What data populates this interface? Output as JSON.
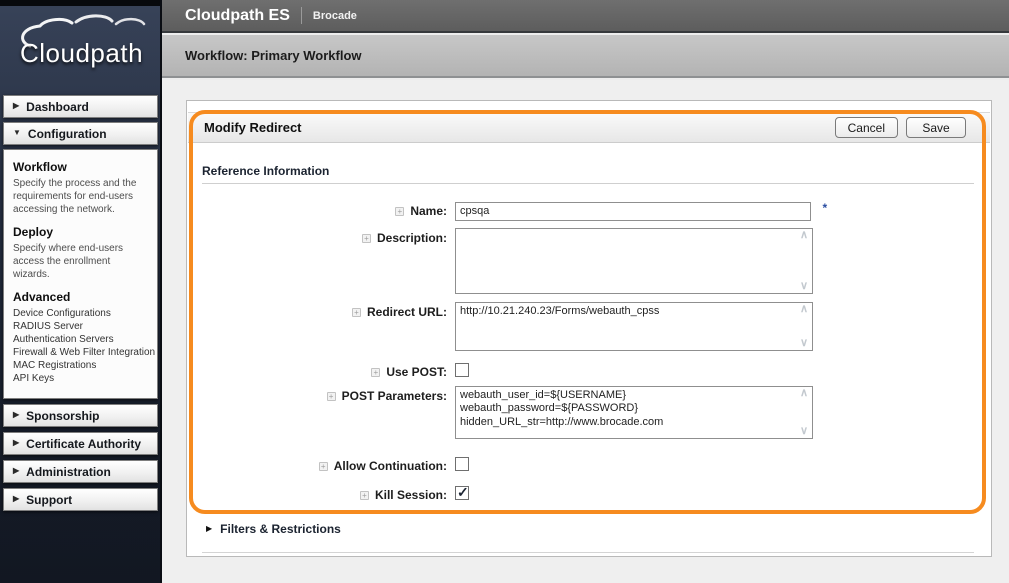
{
  "colors": {
    "accent_orange": "#F68B1F",
    "topbar_gray": "#666666",
    "band_gray": "#BDBDBD",
    "sidebar_navy": "#1C2434",
    "required_blue": "#2B4EA2"
  },
  "logo": {
    "brand": "Cloudpath"
  },
  "topbar": {
    "app_title": "Cloudpath ES",
    "company": "Brocade"
  },
  "band": {
    "page_title": "Workflow: Primary Workflow"
  },
  "sidebar": {
    "items": [
      {
        "label": "Dashboard",
        "state": "collapsed"
      },
      {
        "label": "Configuration",
        "state": "expanded"
      },
      {
        "label": "Sponsorship",
        "state": "collapsed"
      },
      {
        "label": "Certificate Authority",
        "state": "collapsed"
      },
      {
        "label": "Administration",
        "state": "collapsed"
      },
      {
        "label": "Support",
        "state": "collapsed"
      }
    ],
    "config_menu": {
      "workflow_title": "Workflow",
      "workflow_desc": "Specify the process and the requirements for end-users accessing the network.",
      "deploy_title": "Deploy",
      "deploy_desc": "Specify where end-users access the enrollment wizards.",
      "advanced_title": "Advanced",
      "advanced_links": [
        "Device Configurations",
        "RADIUS Server",
        "Authentication Servers",
        "Firewall & Web Filter Integration",
        "MAC Registrations",
        "API Keys"
      ]
    }
  },
  "panel": {
    "title": "Modify Redirect",
    "buttons": {
      "cancel": "Cancel",
      "save": "Save"
    },
    "section": "Reference Information",
    "fields": {
      "name": {
        "label": "Name:",
        "value": "cpsqa",
        "required_marker": "*"
      },
      "description": {
        "label": "Description:",
        "value": ""
      },
      "redirect_url": {
        "label": "Redirect URL:",
        "value": "http://10.21.240.23/Forms/webauth_cpss"
      },
      "use_post": {
        "label": "Use POST:",
        "checked": false
      },
      "post_parameters": {
        "label": "POST Parameters:",
        "value": "webauth_user_id=${USERNAME}\nwebauth_password=${PASSWORD}\nhidden_URL_str=http://www.brocade.com"
      },
      "allow_continuation": {
        "label": "Allow Continuation:",
        "checked": false
      },
      "kill_session": {
        "label": "Kill Session:",
        "checked": true
      }
    },
    "collapsed_section": "Filters & Restrictions"
  },
  "glyphs": {
    "collapsed_arrow": "▶",
    "expanded_arrow": "▼",
    "scroll_up": "∧",
    "scroll_down": "∨"
  }
}
